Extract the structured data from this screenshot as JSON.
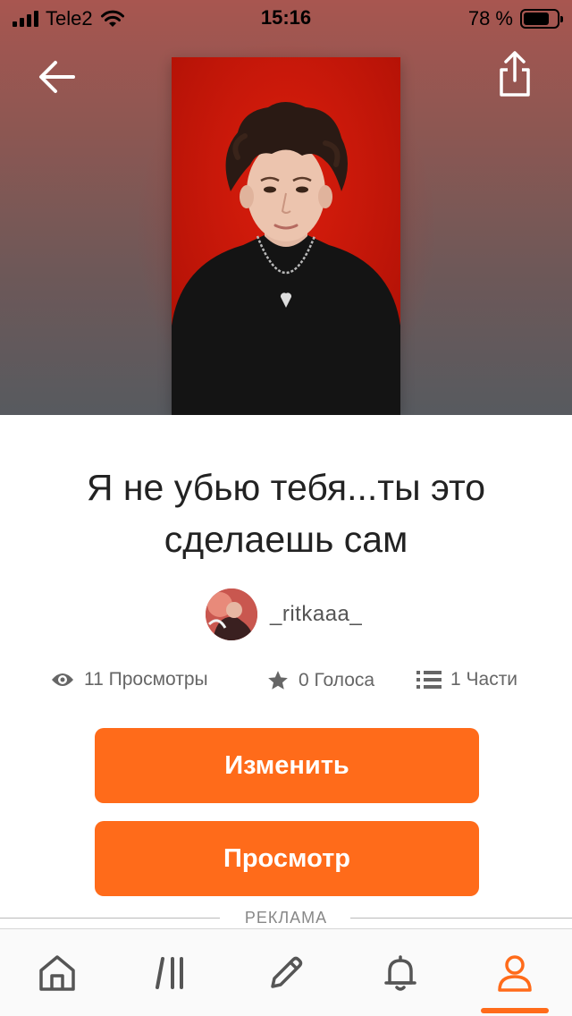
{
  "status_bar": {
    "carrier": "Tele2",
    "time": "15:16",
    "battery": "78 %",
    "battery_level": 0.78
  },
  "story": {
    "title": "Я не убью тебя...ты это сделаешь сам",
    "author": "_ritkaaa_",
    "cover_color": "#d11a08"
  },
  "stats": {
    "views": "11 Просмотры",
    "votes": "0 Голоса",
    "parts": "1 Части"
  },
  "buttons": {
    "edit": "Изменить",
    "view": "Просмотр"
  },
  "ad_label": "РЕКЛАМА",
  "tabbar": {
    "active": "profile",
    "accent": "#ff6b1a",
    "icon_color": "#555555",
    "items": [
      {
        "id": "home",
        "icon": "home-icon"
      },
      {
        "id": "library",
        "icon": "library-icon"
      },
      {
        "id": "write",
        "icon": "pencil-icon"
      },
      {
        "id": "notifications",
        "icon": "bell-icon"
      },
      {
        "id": "profile",
        "icon": "profile-icon"
      }
    ]
  }
}
